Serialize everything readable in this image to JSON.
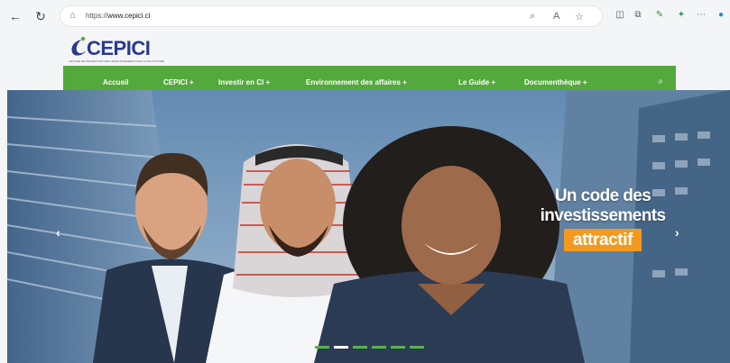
{
  "browser": {
    "url_prefix": "https://",
    "url_host": "www.cepici.ci"
  },
  "site": {
    "logo_text": "CEPICI",
    "logo_tagline": "CENTRE DE PROMOTION DES INVESTISSEMENTS EN COTE D'IVOIRE",
    "brand_color": "#2a3a8c",
    "accent_color": "#54a93c"
  },
  "menu": {
    "items": [
      {
        "label": "Accueil"
      },
      {
        "label": "CEPICI +"
      },
      {
        "label": "Investir en CI +"
      },
      {
        "label": "Environnement des affaires +"
      },
      {
        "label": "Le Guide +"
      },
      {
        "label": "Documenthèque +"
      }
    ]
  },
  "hero": {
    "line1": "Un code des",
    "line2": "investissements",
    "line3": "attractif",
    "highlight_color": "#f39a1e",
    "slides_total": 7,
    "active_slide": 2
  }
}
